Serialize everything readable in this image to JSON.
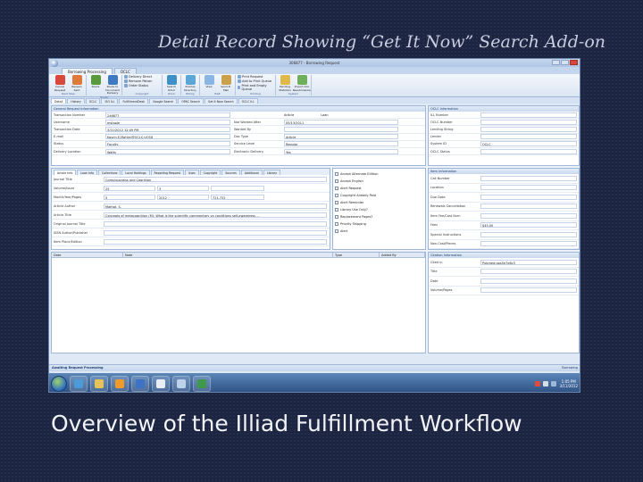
{
  "slide": {
    "title": "Detail Record Showing “Get It Now” Search Add-on",
    "caption": "Overview of the Illiad Fulfillment Workflow"
  },
  "window": {
    "title": "306877 - Borrowing Request",
    "app_tabs": [
      "Borrowing Processing",
      "OCLC"
    ]
  },
  "ribbon": {
    "groups": [
      {
        "label": "Next Step",
        "buttons": [
          {
            "label": "Cancel Request",
            "color": "#d9493b"
          },
          {
            "label": "Reopen Sent",
            "color": "#e07a3c"
          }
        ]
      },
      {
        "label": "Route",
        "buttons": [
          {
            "label": "Route",
            "color": "#5a9a3a"
          },
          {
            "label": "Route to Document Delivery",
            "color": "#3d7ac2"
          }
        ]
      },
      {
        "label": "Copyright",
        "small": [
          "Delivery Direct",
          "Remove Patron",
          "Order Status"
        ]
      },
      {
        "label": "OCLC",
        "buttons": [
          {
            "label": "Search OCLC",
            "color": "#3f8fc9"
          }
        ]
      },
      {
        "label": "Billing",
        "buttons": [
          {
            "label": "Policies Directory",
            "color": "#5aa6d6"
          }
        ]
      },
      {
        "label": "E&E",
        "buttons": [
          {
            "label": "View",
            "color": "#8ab6e3"
          },
          {
            "label": "Send E-Mail",
            "color": "#c8a14a"
          }
        ]
      },
      {
        "label": "Printing",
        "small": [
          "Print Request",
          "Add to Print Queue",
          "Print and Empty Queue"
        ]
      },
      {
        "label": "System",
        "buttons": [
          {
            "label": "Pending Statistics",
            "color": "#e0b94a"
          },
          {
            "label": "Import into Resubmission",
            "color": "#6fae5a"
          }
        ]
      }
    ]
  },
  "subtabs": [
    "Detail",
    "History",
    "OCLC",
    "ISO ILL",
    "FulfillmentDesk",
    "Google Search",
    "OPAC Search",
    "Get It Now Search",
    "OCLC ILL"
  ],
  "general": {
    "header": "General Request Information",
    "rows": [
      {
        "label": "Transaction Number",
        "value": "246877",
        "label2": "",
        "value2": ""
      },
      {
        "label": "Username",
        "value": "mstaple",
        "label2": "Not Wanted After",
        "value2": "05/13/2011"
      },
      {
        "label": "Transaction Date",
        "value": "3/11/2012 12:09 PM",
        "label2": "Wanted By",
        "value2": ""
      },
      {
        "label": "E-mail",
        "value": "Kosrin.E.Mahler@OCLC.UCSD",
        "label2": "Doc Type",
        "value2": "Article"
      },
      {
        "label": "Status",
        "value": "Faculty",
        "label2": "Service Level",
        "value2": "Regular"
      },
      {
        "label": "Delivery Location",
        "value": "Watts",
        "label2": "Electronic Delivery",
        "value2": "Yes"
      }
    ],
    "radios": [
      "Article",
      "Loan"
    ]
  },
  "oclc": {
    "header": "OCLC Information",
    "rows": [
      "ILL Number",
      "OCLC Number",
      "Lending String",
      "Lender",
      "System ID",
      "OCLC Status"
    ],
    "system_value": "OCLC"
  },
  "article_tabs": [
    "Article Info",
    "Loan Info",
    "Collections",
    "Local Holdings",
    "Reporting Request",
    "Uses",
    "Copyright",
    "Sources",
    "Additional",
    "Library"
  ],
  "article": {
    "rows": [
      {
        "label": "Journal Title",
        "value": "Consciousness and Cognition",
        "extra1": "",
        "extra2": ""
      },
      {
        "label": "Volume/Issue",
        "value": "25",
        "extra1": "3",
        "extra2": ""
      },
      {
        "label": "Month/Year/Pages",
        "value": "5",
        "extra1": "2012",
        "extra2": "721-732"
      },
      {
        "label": "Article Author",
        "value": "Mathot, S.",
        "extra1": "",
        "extra2": ""
      },
      {
        "label": "Article Title",
        "value": "Concepts of metacognition (M): What is the scientific commentary on conditions self-awareness ...",
        "extra1": "",
        "extra2": ""
      },
      {
        "label": "Original Journal Title",
        "value": "",
        "extra1": "",
        "extra2": ""
      },
      {
        "label": "ISSN Author/Publisher",
        "value": "",
        "extra1": "",
        "extra2": ""
      },
      {
        "label": "Item Place/Edition",
        "value": "",
        "extra1": "",
        "extra2": ""
      }
    ]
  },
  "checks": [
    "Accept Alternate Edition",
    "Accept English",
    "Alert Request",
    "Copyright Already Paid",
    "Alert Reminder",
    "Library Use Only?",
    "Replacement Pages?",
    "Priority Shipping",
    "Alert"
  ],
  "item": {
    "header": "Item Information",
    "rows": [
      {
        "label": "Call Number",
        "value": ""
      },
      {
        "label": "Location",
        "value": ""
      },
      {
        "label": "Due Date",
        "value": ""
      },
      {
        "label": "Renewals Cancellation",
        "value": ""
      },
      {
        "label": "Item Fee/Cost Num",
        "value": ""
      },
      {
        "label": "Fees",
        "value": "$45.00"
      },
      {
        "label": "Special Instructions",
        "value": ""
      },
      {
        "label": "Non-Cost/Pieces",
        "value": ""
      }
    ]
  },
  "notes": {
    "columns": [
      "Date",
      "Note",
      "Type",
      "Added By"
    ]
  },
  "citation": {
    "header": "Citation Information",
    "rows": [
      {
        "label": "Cited in",
        "value": "Pubmed:qps5e7e8c3"
      },
      {
        "label": "Title",
        "value": ""
      },
      {
        "label": "Date",
        "value": ""
      },
      {
        "label": "Volume/Pages",
        "value": ""
      }
    ]
  },
  "status": {
    "left": "Awaiting Request Processing",
    "right": "Borrowing"
  },
  "taskbar": {
    "icons": [
      {
        "name": "ie-icon",
        "color": "#4b9bd8"
      },
      {
        "name": "folder-icon",
        "color": "#e6c35a"
      },
      {
        "name": "media-player-icon",
        "color": "#f09a2a"
      },
      {
        "name": "outlook-icon",
        "color": "#3d72c4"
      },
      {
        "name": "illiad-icon",
        "color": "#e9eef5"
      },
      {
        "name": "calculator-icon",
        "color": "#bcd2ea"
      },
      {
        "name": "excel-icon",
        "color": "#3e9a4a"
      }
    ],
    "time": "1:05 PM",
    "date": "3/11/2012"
  }
}
